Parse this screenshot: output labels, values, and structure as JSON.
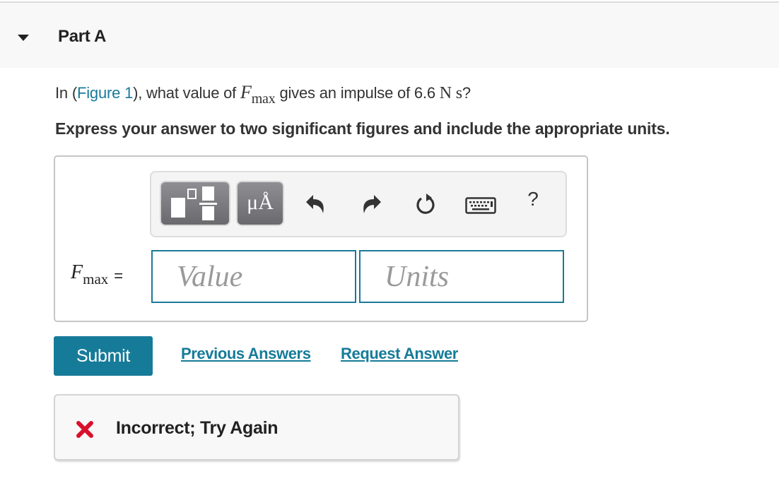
{
  "part": {
    "title": "Part A",
    "expanded": true
  },
  "question": {
    "prefix": "In (",
    "figure_link": "Figure 1",
    "middle": "), what value of ",
    "var_symbol": "F",
    "var_sub": "max",
    "suffix": " gives an impulse of 6.6 ",
    "unit": "N s",
    "end": "?"
  },
  "instruction": "Express your answer to two significant figures and include the appropriate units.",
  "toolbar": {
    "templates_icon": "templates-icon",
    "units_label": "μÅ",
    "undo_icon": "undo-icon",
    "redo_icon": "redo-icon",
    "reset_icon": "reset-icon",
    "keyboard_icon": "keyboard-icon",
    "help_label": "?"
  },
  "answer": {
    "label_symbol": "F",
    "label_sub": "max",
    "equals": "=",
    "value_placeholder": "Value",
    "value": "",
    "units_placeholder": "Units",
    "units": ""
  },
  "actions": {
    "submit_label": "Submit",
    "previous_answers_label": "Previous Answers",
    "request_answer_label": "Request Answer"
  },
  "feedback": {
    "status": "incorrect",
    "message": "Incorrect; Try Again",
    "color": "#d9102c"
  },
  "colors": {
    "accent": "#167b99",
    "error": "#d9102c"
  }
}
